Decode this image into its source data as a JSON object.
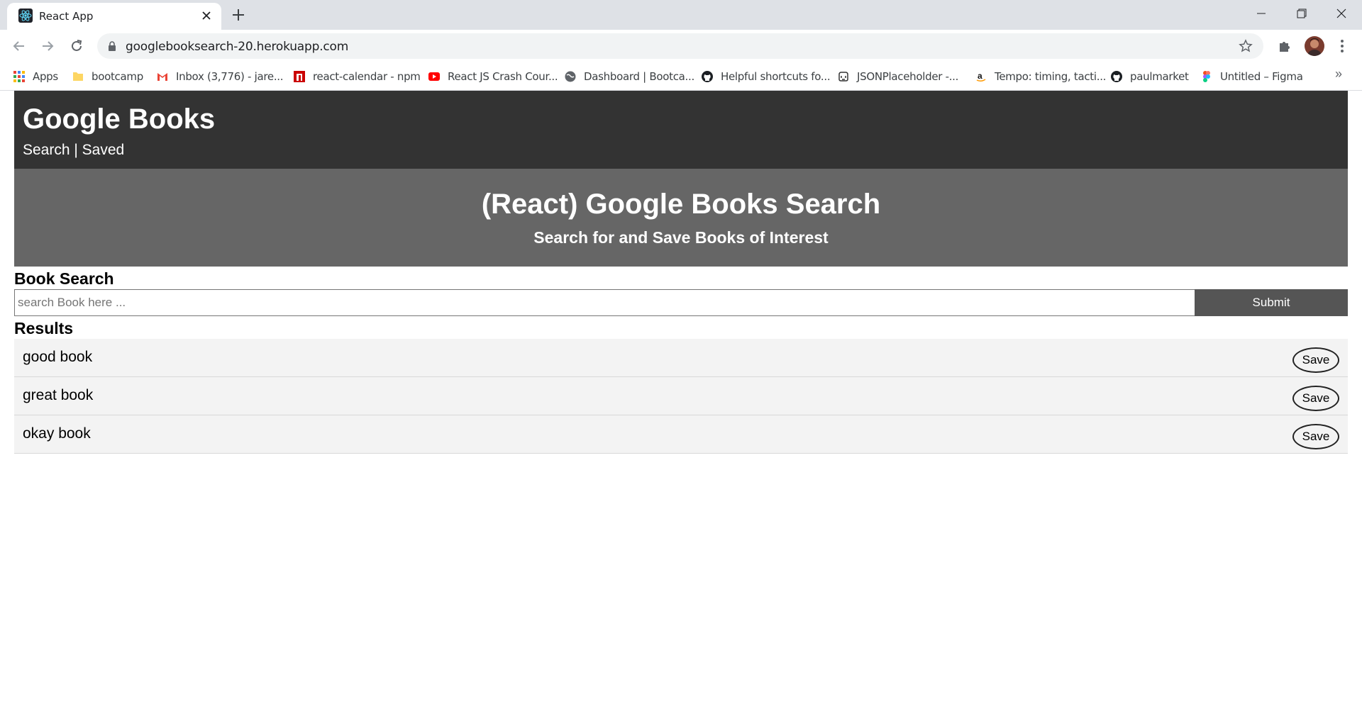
{
  "browser": {
    "tab_title": "React App",
    "url": "googlebooksearch-20.herokuapp.com",
    "bookmarks": [
      {
        "label": "Apps",
        "icon": "apps-grid-icon"
      },
      {
        "label": "bootcamp",
        "icon": "folder-icon"
      },
      {
        "label": "Inbox (3,776) - jare...",
        "icon": "gmail-icon"
      },
      {
        "label": "react-calendar - npm",
        "icon": "npm-icon"
      },
      {
        "label": "React JS Crash Cour...",
        "icon": "youtube-icon"
      },
      {
        "label": "Dashboard | Bootca...",
        "icon": "globe-icon"
      },
      {
        "label": "Helpful shortcuts fo...",
        "icon": "github-icon"
      },
      {
        "label": "JSONPlaceholder -...",
        "icon": "jsonplaceholder-icon"
      },
      {
        "label": "Tempo: timing, tacti...",
        "icon": "amazon-icon"
      },
      {
        "label": "paulmarket",
        "icon": "github-icon"
      },
      {
        "label": "Untitled – Figma",
        "icon": "figma-icon"
      }
    ],
    "more_bookmarks": "»"
  },
  "app": {
    "brand": "Google Books",
    "nav": {
      "search": "Search",
      "separator": " | ",
      "saved": "Saved"
    },
    "hero": {
      "title": "(React) Google Books Search",
      "subtitle": "Search for and Save Books of Interest"
    },
    "search": {
      "title": "Book Search",
      "placeholder": "search Book here ...",
      "submit_label": "Submit"
    },
    "results": {
      "title": "Results",
      "items": [
        {
          "title": "good book",
          "save_label": "Save"
        },
        {
          "title": "great book",
          "save_label": "Save"
        },
        {
          "title": "okay book",
          "save_label": "Save"
        }
      ]
    }
  }
}
